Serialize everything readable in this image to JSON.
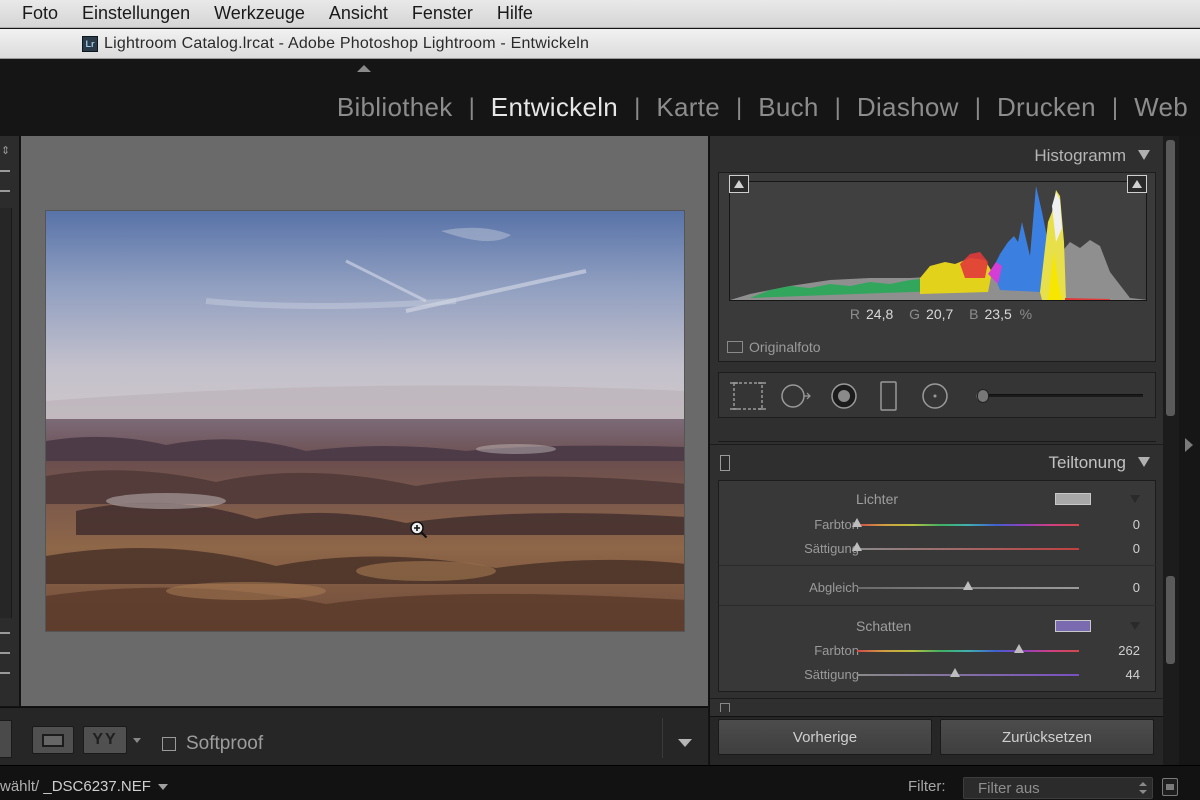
{
  "menubar": {
    "items": [
      "Foto",
      "Einstellungen",
      "Werkzeuge",
      "Ansicht",
      "Fenster",
      "Hilfe"
    ]
  },
  "window": {
    "title": "Lightroom Catalog.lrcat - Adobe Photoshop Lightroom - Entwickeln",
    "app_icon_text": "Lr"
  },
  "modules": {
    "items": [
      {
        "label": "Bibliothek",
        "active": false
      },
      {
        "label": "Entwickeln",
        "active": true
      },
      {
        "label": "Karte",
        "active": false
      },
      {
        "label": "Buch",
        "active": false
      },
      {
        "label": "Diashow",
        "active": false
      },
      {
        "label": "Drucken",
        "active": false
      },
      {
        "label": "Web",
        "active": false
      }
    ],
    "separator": "|"
  },
  "toolbar": {
    "yy_label": "YY",
    "softproof_label": "Softproof",
    "softproof_checked": false
  },
  "histogram": {
    "title": "Histogramm",
    "r_label": "R",
    "r_value": "24,8",
    "g_label": "G",
    "g_value": "20,7",
    "b_label": "B",
    "b_value": "23,5",
    "unit": "%",
    "original_label": "Originalfoto"
  },
  "tools": {
    "items": [
      "crop-overlay",
      "spot-removal",
      "red-eye",
      "graduated-filter",
      "radial-filter",
      "adjustment-brush"
    ],
    "slider_value": 0
  },
  "split_toning": {
    "title": "Teiltonung",
    "highlights": {
      "title": "Lichter",
      "swatch_color": "#a8a8a8",
      "hue_label": "Farbton",
      "hue_value": "0",
      "hue_fraction": 0.0,
      "sat_label": "Sättigung",
      "sat_value": "0",
      "sat_fraction": 0.0
    },
    "balance": {
      "label": "Abgleich",
      "value": "0",
      "fraction": 0.5
    },
    "shadows": {
      "title": "Schatten",
      "swatch_color": "#7a6bb0",
      "hue_label": "Farbton",
      "hue_value": "262",
      "hue_fraction": 0.7278,
      "sat_label": "Sättigung",
      "sat_value": "44",
      "sat_fraction": 0.44
    }
  },
  "buttons": {
    "previous": "Vorherige",
    "reset": "Zurücksetzen"
  },
  "filmstrip": {
    "path_prefix": "wählt/",
    "filename": "_DSC6237.NEF",
    "filter_label": "Filter:",
    "filter_value": "Filter aus"
  },
  "colors": {
    "accent_active_module": "#e6e6e6",
    "panel_bg": "#2f2f2f",
    "canvas_bg": "#6a6a6a"
  }
}
